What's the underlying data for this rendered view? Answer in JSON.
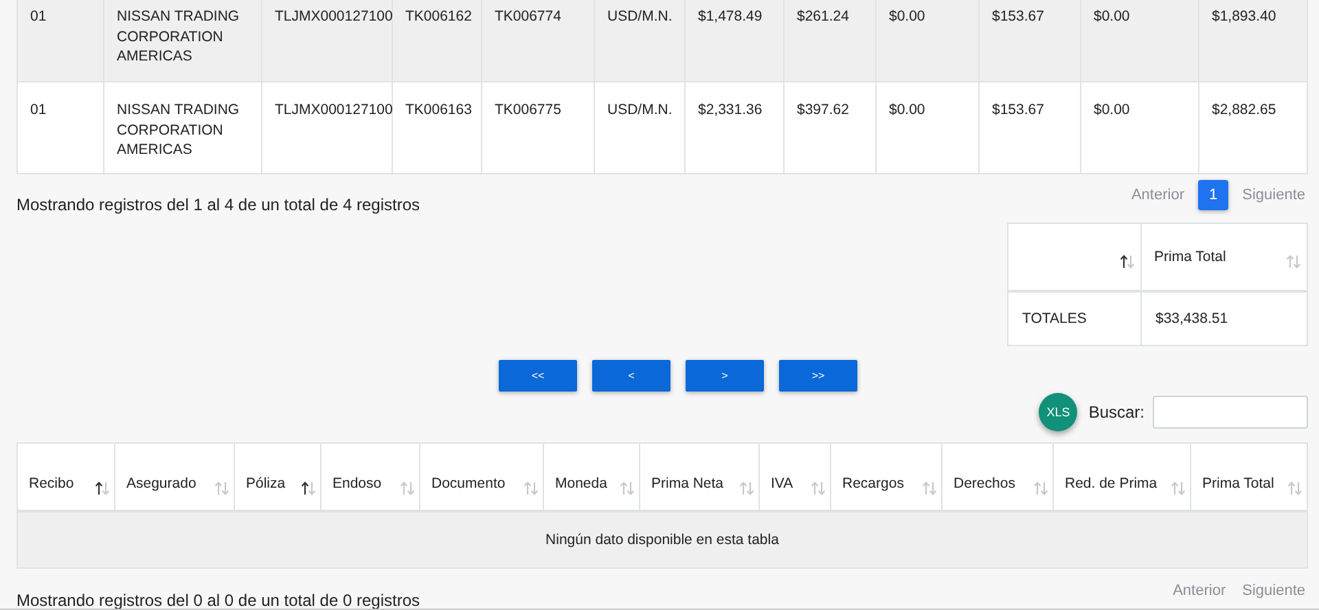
{
  "results_table": {
    "rows": [
      {
        "cells": [
          "01",
          "NISSAN TRADING CORPORATION AMERICAS",
          "TLJMX000127100",
          "TK006162",
          "TK006774",
          "USD/M.N.",
          "$1,478.49",
          "$261.24",
          "$0.00",
          "$153.67",
          "$0.00",
          "$1,893.40"
        ]
      },
      {
        "cells": [
          "01",
          "NISSAN TRADING CORPORATION AMERICAS",
          "TLJMX000127100",
          "TK006163",
          "TK006775",
          "USD/M.N.",
          "$2,331.36",
          "$397.62",
          "$0.00",
          "$153.67",
          "$0.00",
          "$2,882.65"
        ]
      }
    ]
  },
  "results_info": "Mostrando registros del 1 al 4 de un total de 4 registros",
  "results_pagination": {
    "previous": {
      "label": "Anterior",
      "disabled": true
    },
    "pages": [
      {
        "label": "1",
        "selected": true
      }
    ],
    "next": {
      "label": "Siguiente",
      "disabled": true
    }
  },
  "totals_table": {
    "columns": [
      {
        "sorted": true
      },
      {
        "label": "Prima Total",
        "sorted": false
      }
    ],
    "rows": [
      {
        "cells": [
          "TOTALES",
          "$33,438.51"
        ]
      }
    ]
  },
  "nav_buttons": [
    "<<",
    "<",
    ">",
    ">>"
  ],
  "export_button": "XLS",
  "search": {
    "label": "Buscar:"
  },
  "receipts_table": {
    "columns": [
      {
        "label": "Recibo",
        "sorted": true
      },
      {
        "label": "Asegurado",
        "sorted": false
      },
      {
        "label": "Póliza",
        "sorted": true
      },
      {
        "label": "Endoso",
        "sorted": false
      },
      {
        "label": "Documento",
        "sorted": false
      },
      {
        "label": "Moneda",
        "sorted": false
      },
      {
        "label": "Prima Neta",
        "sorted": false
      },
      {
        "label": "IVA",
        "sorted": false
      },
      {
        "label": "Recargos",
        "sorted": false
      },
      {
        "label": "Derechos",
        "sorted": false
      },
      {
        "label": "Red. de Prima",
        "sorted": false
      },
      {
        "label": "Prima Total",
        "sorted": false
      }
    ],
    "empty_message": "Ningún dato disponible en esta tabla"
  },
  "receipts_info": "Mostrando registros del 0 al 0 de un total de 0 registros",
  "receipts_pagination": {
    "previous": {
      "label": "Anterior",
      "disabled": true
    },
    "next": {
      "label": "Siguiente",
      "disabled": true
    }
  }
}
